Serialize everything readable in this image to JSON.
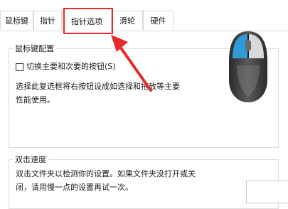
{
  "tabs": [
    {
      "label": "鼠标键"
    },
    {
      "label": "指针"
    },
    {
      "label": "指针选项"
    },
    {
      "label": "滑轮"
    },
    {
      "label": "硬件"
    }
  ],
  "button_config": {
    "title": "鼠标键配置",
    "switch_checkbox_label": "切换主要和次要的按钮(S)",
    "switch_checked": false,
    "description_line1": "选择此复选框将右按钮设成如选择和拖放等主要",
    "description_line2": "性能使用。"
  },
  "double_click": {
    "title": "双击速度",
    "description_line1": "双击文件夹以检测你的设置。如果文件夹没打开或关",
    "description_line2": "闭，请用慢一点的设置再试一次。"
  },
  "annotation": {
    "highlight_color": "#e52a2a"
  },
  "icons": {
    "mouse": "mouse-illustration-icon",
    "arrow": "red-arrow-icon"
  },
  "colors": {
    "mouse_accent": "#2f9bd8",
    "mouse_body": "#4a4a4a"
  }
}
